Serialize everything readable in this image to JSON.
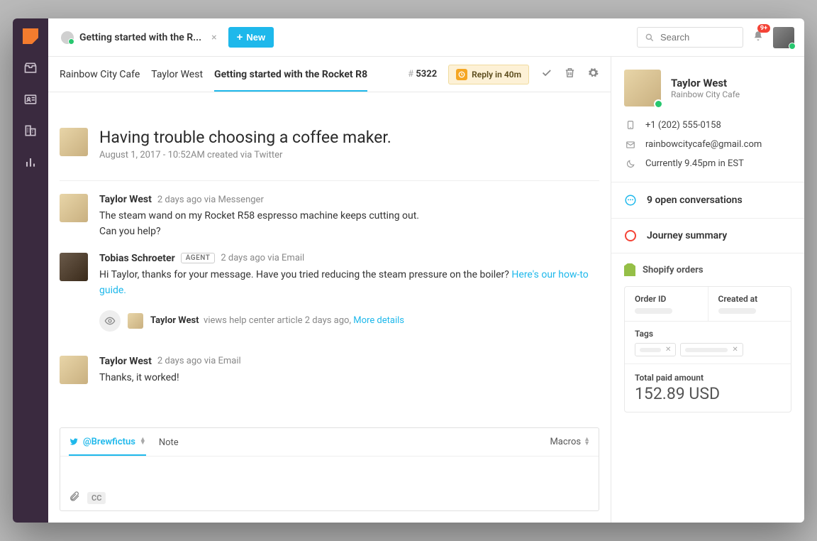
{
  "topbar": {
    "tab_title": "Getting started with the R...",
    "new_label": "New",
    "search_placeholder": "Search",
    "notif_badge": "9+"
  },
  "subhead": {
    "crumb1": "Rainbow City Cafe",
    "crumb2": "Taylor West",
    "crumb3": "Getting started with the Rocket R8",
    "ticket_hash": "#",
    "ticket_id": "5322",
    "reply_in": "Reply in 40m"
  },
  "hero": {
    "title": "Having trouble choosing a coffee maker.",
    "meta": "August 1, 2017 - 10:52AM created via Twitter"
  },
  "messages": [
    {
      "author": "Taylor West",
      "meta": "2 days ago via Messenger",
      "text": "The steam wand on my Rocket R58 espresso machine keeps cutting out.\nCan you help?"
    },
    {
      "author": "Tobias Schroeter",
      "badge": "AGENT",
      "meta": "2 days ago via Email",
      "text": "Hi Taylor, thanks for your message. Have you tried reducing the steam pressure on the boiler?",
      "link": "Here's our how-to guide."
    }
  ],
  "event": {
    "author": "Taylor West",
    "text": "views help center article 2 days ago,",
    "link": "More details"
  },
  "message3": {
    "author": "Taylor West",
    "meta": "2 days ago via Email",
    "text": "Thanks, it worked!"
  },
  "composer": {
    "handle": "@Brewfictus",
    "note": "Note",
    "macros": "Macros",
    "cc": "CC"
  },
  "customer": {
    "name": "Taylor West",
    "org": "Rainbow City Cafe",
    "phone": "+1 (202) 555-0158",
    "email": "rainbowcitycafe@gmail.com",
    "time": "Currently 9.45pm in EST",
    "open_conv": "9 open conversations",
    "journey": "Journey summary"
  },
  "shopify": {
    "title": "Shopify orders",
    "order_id_label": "Order ID",
    "created_at_label": "Created at",
    "tags_label": "Tags",
    "total_label": "Total paid amount",
    "total_value": "152.89 USD"
  }
}
